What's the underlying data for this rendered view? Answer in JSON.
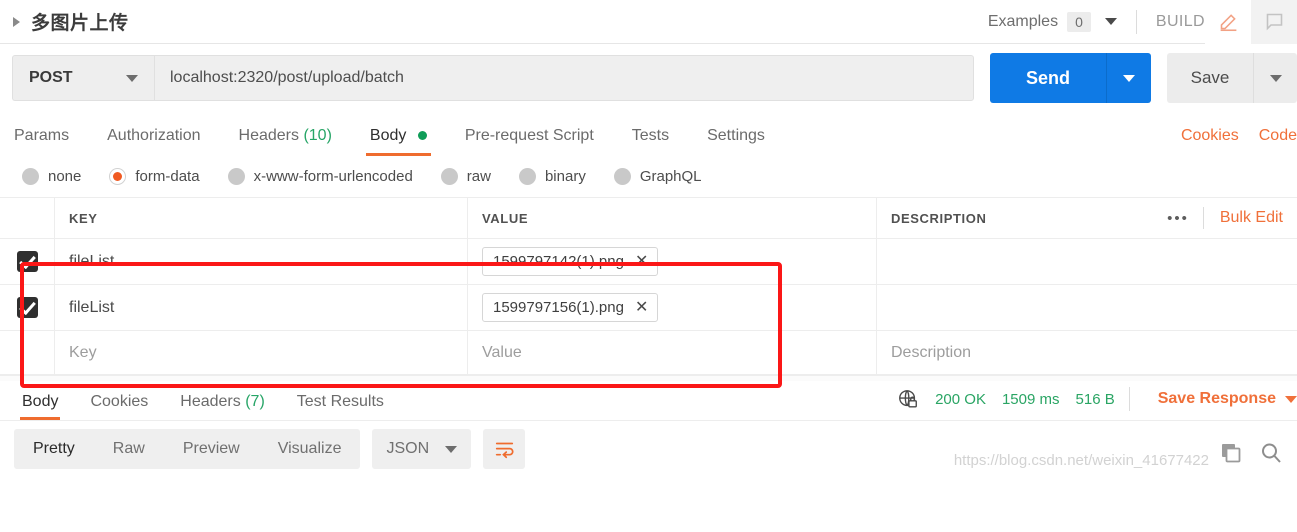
{
  "titlebar": {
    "request_name": "多图片上传",
    "examples_label": "Examples",
    "examples_count": "0",
    "build_label": "BUILD",
    "edit_icon": "pencil-icon",
    "comment_icon": "comment-icon"
  },
  "url_row": {
    "method": "POST",
    "url": "localhost:2320/post/upload/batch",
    "send_label": "Send",
    "save_label": "Save"
  },
  "request_tabs": {
    "items": [
      {
        "label": "Params",
        "selected": false
      },
      {
        "label": "Authorization",
        "selected": false
      },
      {
        "label": "Headers",
        "count": "(10)",
        "selected": false
      },
      {
        "label": "Body",
        "selected": true,
        "dot": true
      },
      {
        "label": "Pre-request Script",
        "selected": false
      },
      {
        "label": "Tests",
        "selected": false
      },
      {
        "label": "Settings",
        "selected": false
      }
    ],
    "cookies_link": "Cookies",
    "code_link": "Code"
  },
  "body_types": [
    {
      "label": "none",
      "selected": false
    },
    {
      "label": "form-data",
      "selected": true
    },
    {
      "label": "x-www-form-urlencoded",
      "selected": false
    },
    {
      "label": "raw",
      "selected": false
    },
    {
      "label": "binary",
      "selected": false
    },
    {
      "label": "GraphQL",
      "selected": false
    }
  ],
  "form_table": {
    "headers": {
      "key": "KEY",
      "value": "VALUE",
      "description": "DESCRIPTION"
    },
    "more_icon": "•••",
    "bulk_edit": "Bulk Edit",
    "rows": [
      {
        "checked": true,
        "key": "fileList",
        "value": "1599797142(1).png",
        "remove_icon": "✕",
        "description": ""
      },
      {
        "checked": true,
        "key": "fileList",
        "value": "1599797156(1).png",
        "remove_icon": "✕",
        "description": ""
      }
    ],
    "placeholder_row": {
      "key": "Key",
      "value": "Value",
      "description": "Description"
    }
  },
  "annotation": {
    "color": "#fb1717"
  },
  "response": {
    "tabs": [
      {
        "label": "Body",
        "selected": true
      },
      {
        "label": "Cookies",
        "selected": false
      },
      {
        "label": "Headers",
        "count": "(7)",
        "selected": false
      },
      {
        "label": "Test Results",
        "selected": false
      }
    ],
    "status_icon": "globe-lock-icon",
    "status": "200 OK",
    "time": "1509 ms",
    "size": "516 B",
    "save_response": "Save Response"
  },
  "viewer_toolbar": {
    "modes": [
      {
        "label": "Pretty",
        "selected": true
      },
      {
        "label": "Raw",
        "selected": false
      },
      {
        "label": "Preview",
        "selected": false
      },
      {
        "label": "Visualize",
        "selected": false
      }
    ],
    "format": "JSON",
    "wrap_icon": "word-wrap-icon",
    "copy_icon": "copy-icon",
    "search_icon": "search-icon"
  },
  "watermark": "https://blog.csdn.net/weixin_41677422",
  "colors": {
    "accent_orange": "#ef6c2e",
    "send_blue": "#0f7ae5",
    "status_green": "#2aa564",
    "annotation_red": "#fb1717"
  }
}
